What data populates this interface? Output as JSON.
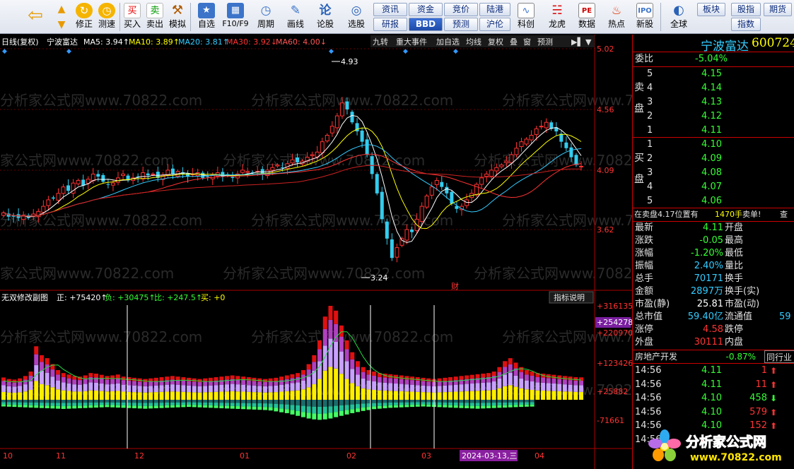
{
  "toolbar": {
    "buttons": [
      {
        "label": "",
        "icon": "back-arrow-icon"
      },
      {
        "label": "",
        "icon": "up-arrow-icon"
      },
      {
        "label": "修正",
        "icon": "fix-icon"
      },
      {
        "label": "测速",
        "icon": "clock-icon"
      },
      {
        "label": "买入",
        "icon": "buy-icon"
      },
      {
        "label": "卖出",
        "icon": "sell-icon"
      },
      {
        "label": "模拟",
        "icon": "hammer-icon"
      },
      {
        "label": "自选",
        "icon": "star-folder-icon"
      },
      {
        "label": "F10/F9",
        "icon": "table-icon"
      },
      {
        "label": "周期",
        "icon": "period-clock-icon"
      },
      {
        "label": "画线",
        "icon": "pencil-icon"
      },
      {
        "label": "论股",
        "icon": "discuss-icon"
      },
      {
        "label": "选股",
        "icon": "stock-select-icon"
      },
      {
        "label": "科创",
        "icon": "kechuang-icon"
      },
      {
        "label": "龙虎",
        "icon": "longhu-icon"
      },
      {
        "label": "数据",
        "icon": "pe-data-icon"
      },
      {
        "label": "热点",
        "icon": "hot-icon"
      },
      {
        "label": "新股",
        "icon": "ipo-icon"
      },
      {
        "label": "全球",
        "icon": "globe-icon"
      }
    ],
    "small_buttons": [
      "资讯",
      "资金",
      "竞价",
      "陆港",
      "研报",
      "BBD",
      "预测",
      "沪伦",
      "板块",
      "股指",
      "指数",
      "期货"
    ]
  },
  "chart_header": {
    "period": "日线(复权)",
    "stock_name": "宁波富达",
    "ma5": "MA5: 3.94↑",
    "ma10": "MA10: 3.89↑",
    "ma20": "MA20: 3.81↑",
    "ma30": "MA30: 3.92↓",
    "ma60": "MA60: 4.00↓",
    "tools": [
      "九转",
      "重大事件",
      "加自选",
      "均线",
      "复权",
      "叠",
      "窗",
      "预测"
    ]
  },
  "main_axis": {
    "ticks": [
      "5.02",
      "4.56",
      "4.09",
      "3.62"
    ],
    "high_label": "4.93",
    "low_label": "3.24",
    "event_marker": "财"
  },
  "indicator": {
    "title": "无双修改副图",
    "zheng": "正: +75420↑",
    "fu": "负: +30475↑",
    "bi": "比: +247.5↑",
    "mai": "买: +0",
    "button": "指标说明",
    "ticks": [
      "+316135",
      "+220970",
      "+123426",
      "+25882",
      "-71661"
    ],
    "highlight_tick": "+254278"
  },
  "date_axis": {
    "labels": [
      "10",
      "11",
      "12",
      "01",
      "02",
      "03",
      "04"
    ],
    "cursor_date": "2024-03-13,三"
  },
  "watermark": "分析家公式网www.70822.com",
  "quote": {
    "title": "宁波富达",
    "code": "600724",
    "weibi_label": "委比",
    "weibi": "-5.04%",
    "sell_side": "卖盘",
    "buy_side": "买盘",
    "sells": [
      {
        "n": "5",
        "p": "4.15"
      },
      {
        "n": "4",
        "p": "4.14"
      },
      {
        "n": "3",
        "p": "4.13"
      },
      {
        "n": "2",
        "p": "4.12"
      },
      {
        "n": "1",
        "p": "4.11"
      }
    ],
    "buys": [
      {
        "n": "1",
        "p": "4.10"
      },
      {
        "n": "2",
        "p": "4.09"
      },
      {
        "n": "3",
        "p": "4.08"
      },
      {
        "n": "4",
        "p": "4.07"
      },
      {
        "n": "5",
        "p": "4.06"
      }
    ],
    "notice": "在卖盘4.17位置有",
    "notice_qty": "1470手",
    "notice_tail": "卖单!",
    "notice_cut": "查",
    "stats": [
      {
        "l": "最新",
        "v": "4.11",
        "c": "c-green",
        "l2": "开盘"
      },
      {
        "l": "涨跌",
        "v": "-0.05",
        "c": "c-green",
        "l2": "最高"
      },
      {
        "l": "涨幅",
        "v": "-1.20%",
        "c": "c-green",
        "l2": "最低"
      },
      {
        "l": "振幅",
        "v": "2.40%",
        "c": "c-cyan",
        "l2": "量比"
      },
      {
        "l": "总手",
        "v": "70171",
        "c": "c-cyan",
        "l2": "换手"
      },
      {
        "l": "金额",
        "v": "2897万",
        "c": "c-cyan",
        "l2": "换手(实)"
      },
      {
        "l": "市盈(静)",
        "v": "25.81",
        "c": "c-white",
        "l2": "市盈(动)"
      },
      {
        "l": "总市值",
        "v": "59.40亿",
        "c": "c-cyan",
        "l2": "流通值"
      },
      {
        "l": "涨停",
        "v": "4.58",
        "c": "c-red",
        "l2": "跌停"
      },
      {
        "l": "外盘",
        "v": "30111",
        "c": "c-red",
        "l2": "内盘"
      }
    ],
    "liutong_cut": "59",
    "sector": "房地产开发",
    "sector_change": "-0.87%",
    "sector_tab": "同行业",
    "ticks": [
      {
        "t": "14:56",
        "p": "4.11",
        "v": "1",
        "dir": "up"
      },
      {
        "t": "14:56",
        "p": "4.11",
        "v": "11",
        "dir": "up"
      },
      {
        "t": "14:56",
        "p": "4.10",
        "v": "458",
        "dir": "down"
      },
      {
        "t": "14:56",
        "p": "4.10",
        "v": "579",
        "dir": "up"
      },
      {
        "t": "14:56",
        "p": "4.10",
        "v": "152",
        "dir": "up"
      },
      {
        "t": "14:56",
        "p": "",
        "v": "",
        "dir": ""
      }
    ]
  },
  "logo": {
    "name": "分析家公式网",
    "url": "www.70822.com"
  },
  "colors": {
    "up": "#ff3333",
    "down": "#33ccee",
    "price_green": "#33ff33",
    "grid_red": "#aa0000"
  },
  "chart_data": {
    "type": "candlestick",
    "axis_ticks": [
      5.02,
      4.56,
      4.09,
      3.62
    ],
    "high": 4.93,
    "low": 3.24,
    "ma": {
      "MA5": 3.94,
      "MA10": 3.89,
      "MA20": 3.81,
      "MA30": 3.92,
      "MA60": 4.0
    },
    "close_series": [
      3.75,
      3.72,
      3.72,
      3.71,
      3.73,
      3.71,
      3.74,
      3.76,
      3.8,
      3.85,
      3.86,
      3.9,
      3.95,
      3.92,
      3.98,
      4.0,
      3.96,
      4.01,
      4.05,
      4.03,
      3.99,
      3.97,
      3.98,
      4.02,
      4.05,
      4.0,
      4.02,
      4.03,
      4.06,
      4.04,
      4.05,
      4.02,
      4.04,
      4.08,
      4.05,
      4.07,
      4.05,
      4.03,
      4.05,
      4.06,
      4.02,
      4.03,
      4.04,
      4.06,
      4.03,
      4.04,
      4.02,
      4.05,
      4.08,
      4.07,
      4.06,
      4.07,
      4.05,
      4.08,
      4.1,
      4.12,
      4.1,
      4.13,
      4.16,
      4.14,
      4.15,
      4.18,
      4.2,
      4.22,
      4.3,
      4.35,
      4.42,
      4.5,
      4.6,
      4.55,
      4.45,
      4.38,
      4.3,
      4.2,
      4.05,
      3.9,
      3.7,
      3.55,
      3.4,
      3.48,
      3.55,
      3.62,
      3.6,
      3.7,
      3.8,
      3.88,
      3.95,
      4.0,
      3.95,
      3.9,
      3.82,
      3.78,
      3.8,
      3.85,
      3.9,
      3.97,
      4.02,
      4.05,
      4.08,
      4.1,
      4.12,
      4.15,
      4.2,
      4.25,
      4.3,
      4.32,
      4.35,
      4.4,
      4.42,
      4.45,
      4.4,
      4.38,
      4.3,
      4.25,
      4.18,
      4.12,
      4.11
    ],
    "indicator_positive": [
      75000,
      70000,
      68000,
      72000,
      80000,
      95000,
      180000,
      150000,
      140000,
      120000,
      100000,
      90000,
      85000,
      80000,
      78000,
      82000,
      90000,
      88000,
      84000,
      80000,
      82000,
      85000,
      78000,
      76000,
      74000,
      72000,
      70000,
      72000,
      74000,
      76000,
      78000,
      80000,
      78000,
      76000,
      74000,
      72000,
      70000,
      72000,
      74000,
      76000,
      78000,
      80000,
      82000,
      80000,
      78000,
      76000,
      74000,
      72000,
      70000,
      72000,
      74000,
      78000,
      82000,
      86000,
      90000,
      100000,
      120000,
      150000,
      200000,
      280000,
      316135,
      300000,
      250000,
      200000,
      160000,
      130000,
      110000,
      100000,
      95000,
      90000,
      88000,
      86000,
      84000,
      82000,
      80000,
      78000,
      76000,
      74000,
      72000,
      70000,
      72000,
      74000,
      76000,
      78000,
      80000,
      82000,
      84000,
      86000,
      88000,
      90000,
      95000,
      110000,
      130000,
      140000,
      125000,
      110000,
      100000,
      95000,
      90000,
      88000,
      86000,
      84000,
      82000,
      80000,
      78000,
      76000,
      75420
    ],
    "indicator_negative": [
      30000,
      31000,
      32000,
      33000,
      34000,
      35000,
      36000,
      37000,
      38000,
      39000,
      40000,
      41000,
      40000,
      39000,
      38000,
      37000,
      36000,
      35000,
      34000,
      33000,
      34000,
      35000,
      36000,
      37000,
      38000,
      39000,
      40000,
      39000,
      38000,
      37000,
      36000,
      35000,
      34000,
      33000,
      32000,
      33000,
      34000,
      35000,
      36000,
      37000,
      38000,
      39000,
      40000,
      41000,
      42000,
      43000,
      44000,
      45000,
      46000,
      48000,
      52000,
      56000,
      60000,
      66000,
      72000,
      78000,
      84000,
      88000,
      90000,
      88000,
      84000,
      78000,
      72000,
      66000,
      60000,
      55000,
      50000,
      46000,
      42000,
      40000,
      38000,
      36000,
      35000,
      34000,
      33000,
      32000,
      31000,
      30000,
      31000,
      32000,
      33000,
      34000,
      35000,
      36000,
      37000,
      38000,
      39000,
      40000,
      39000,
      38000,
      37000,
      36000,
      35000,
      34000,
      33000,
      32000,
      31000,
      30475
    ]
  }
}
